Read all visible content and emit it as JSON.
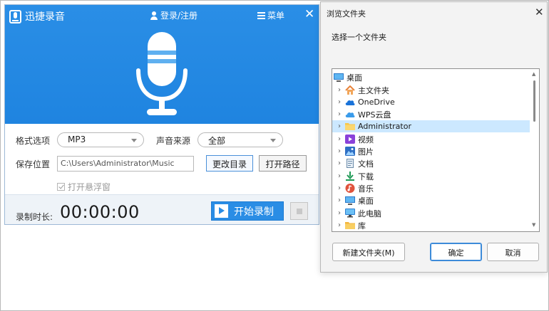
{
  "recorder": {
    "app_title": "迅捷录音",
    "login_label": "登录/注册",
    "menu_label": "菜单",
    "close_glyph": "✕",
    "format_label": "格式选项",
    "format_value": "MP3",
    "source_label": "声音来源",
    "source_value": "全部",
    "save_label": "保存位置",
    "save_path": "C:\\Users\\Administrator\\Music",
    "change_dir_label": "更改目录",
    "open_path_label": "打开路径",
    "float_window_label": "打开悬浮窗",
    "float_window_checked": true,
    "duration_label": "录制时长:",
    "duration_value": "00:00:00",
    "start_label": "开始录制",
    "accent_color": "#1f84e0"
  },
  "dialog": {
    "title": "浏览文件夹",
    "close_glyph": "✕",
    "prompt": "选择一个文件夹",
    "tree": [
      {
        "label": "桌面",
        "icon": "desktop-icon",
        "expander": "",
        "level": 0
      },
      {
        "label": "主文件夹",
        "icon": "home-icon",
        "expander": "›",
        "level": 1
      },
      {
        "label": "OneDrive",
        "icon": "onedrive-cloud-icon",
        "expander": "›",
        "level": 1
      },
      {
        "label": "WPS云盘",
        "icon": "wps-cloud-icon",
        "expander": "›",
        "level": 1
      },
      {
        "label": "Administrator",
        "icon": "folder-icon",
        "expander": "›",
        "level": 1,
        "selected": true
      },
      {
        "label": "视频",
        "icon": "video-icon",
        "expander": "›",
        "level": 1
      },
      {
        "label": "图片",
        "icon": "pictures-icon",
        "expander": "›",
        "level": 1
      },
      {
        "label": "文档",
        "icon": "documents-icon",
        "expander": "›",
        "level": 1
      },
      {
        "label": "下载",
        "icon": "download-icon",
        "expander": "›",
        "level": 1
      },
      {
        "label": "音乐",
        "icon": "music-icon",
        "expander": "›",
        "level": 1
      },
      {
        "label": "桌面",
        "icon": "desktop-icon",
        "expander": "›",
        "level": 1
      },
      {
        "label": "此电脑",
        "icon": "computer-icon",
        "expander": "›",
        "level": 1
      },
      {
        "label": "库",
        "icon": "folder-icon",
        "expander": "›",
        "level": 1
      }
    ],
    "new_folder_label": "新建文件夹(M)",
    "ok_label": "确定",
    "cancel_label": "取消"
  }
}
